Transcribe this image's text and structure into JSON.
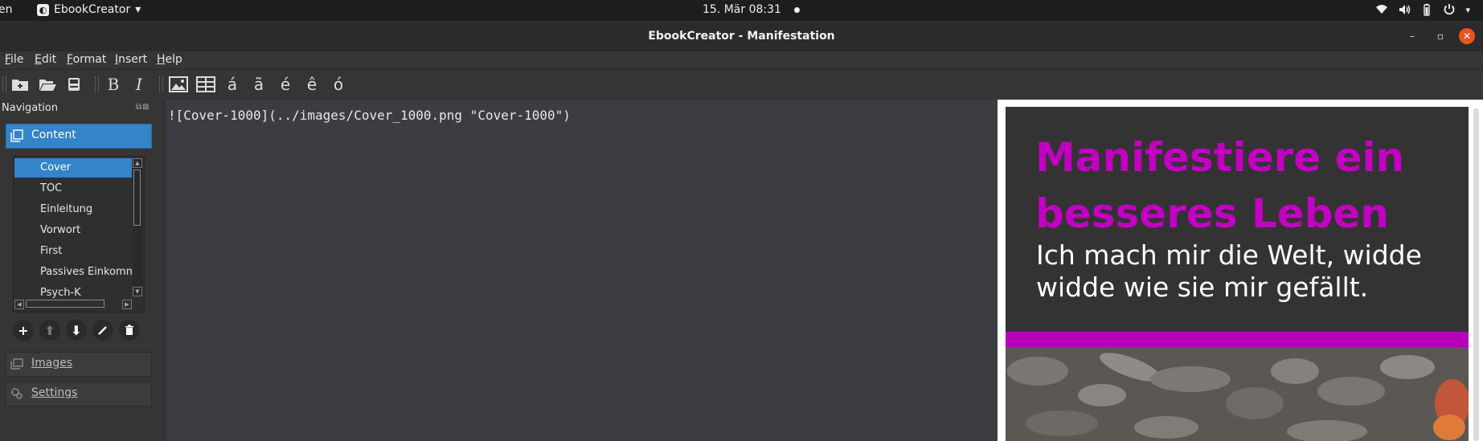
{
  "topbar": {
    "activities": "en",
    "app_name": "EbookCreator",
    "app_menu_arrow": "▾",
    "clock": "15. Mär  08:31",
    "tray_icons": [
      "wifi-icon",
      "volume-icon",
      "battery-icon",
      "power-icon"
    ]
  },
  "window": {
    "title": "EbookCreator - Manifestation",
    "minimize": "–",
    "maximize": "▫",
    "close": "✕"
  },
  "menubar": {
    "items": [
      "File",
      "Edit",
      "Format",
      "Insert",
      "Help"
    ]
  },
  "toolbar": {
    "bold": "B",
    "italic": "I",
    "chars": [
      "á",
      "ã",
      "é",
      "ê",
      "ó"
    ],
    "icons": [
      "new-icon",
      "open-icon",
      "save-icon",
      "insert-image-icon",
      "insert-table-icon"
    ]
  },
  "navigation": {
    "title": "Navigation",
    "sections": {
      "content": "Content",
      "images": "Images",
      "settings": "Settings"
    },
    "pages": [
      "Cover",
      "TOC",
      "Einleitung",
      "Vorwort",
      "First",
      "Passives Einkomm",
      "Psych-K"
    ],
    "selected_index": 0,
    "action_icons": [
      "add-icon",
      "move-up-icon",
      "move-down-icon",
      "edit-icon",
      "delete-icon"
    ]
  },
  "editor": {
    "content": "![Cover-1000](../images/Cover_1000.png \"Cover-1000\")"
  },
  "preview": {
    "heading_line1": "Manifestiere ein",
    "heading_line2": "besseres Leben",
    "subtitle_line1": "Ich mach mir die Welt, widde",
    "subtitle_line2": "widde wie sie mir gefällt."
  },
  "colors": {
    "accent": "#3384c8",
    "cover_magenta": "#c100c1",
    "close_button": "#e95420"
  }
}
